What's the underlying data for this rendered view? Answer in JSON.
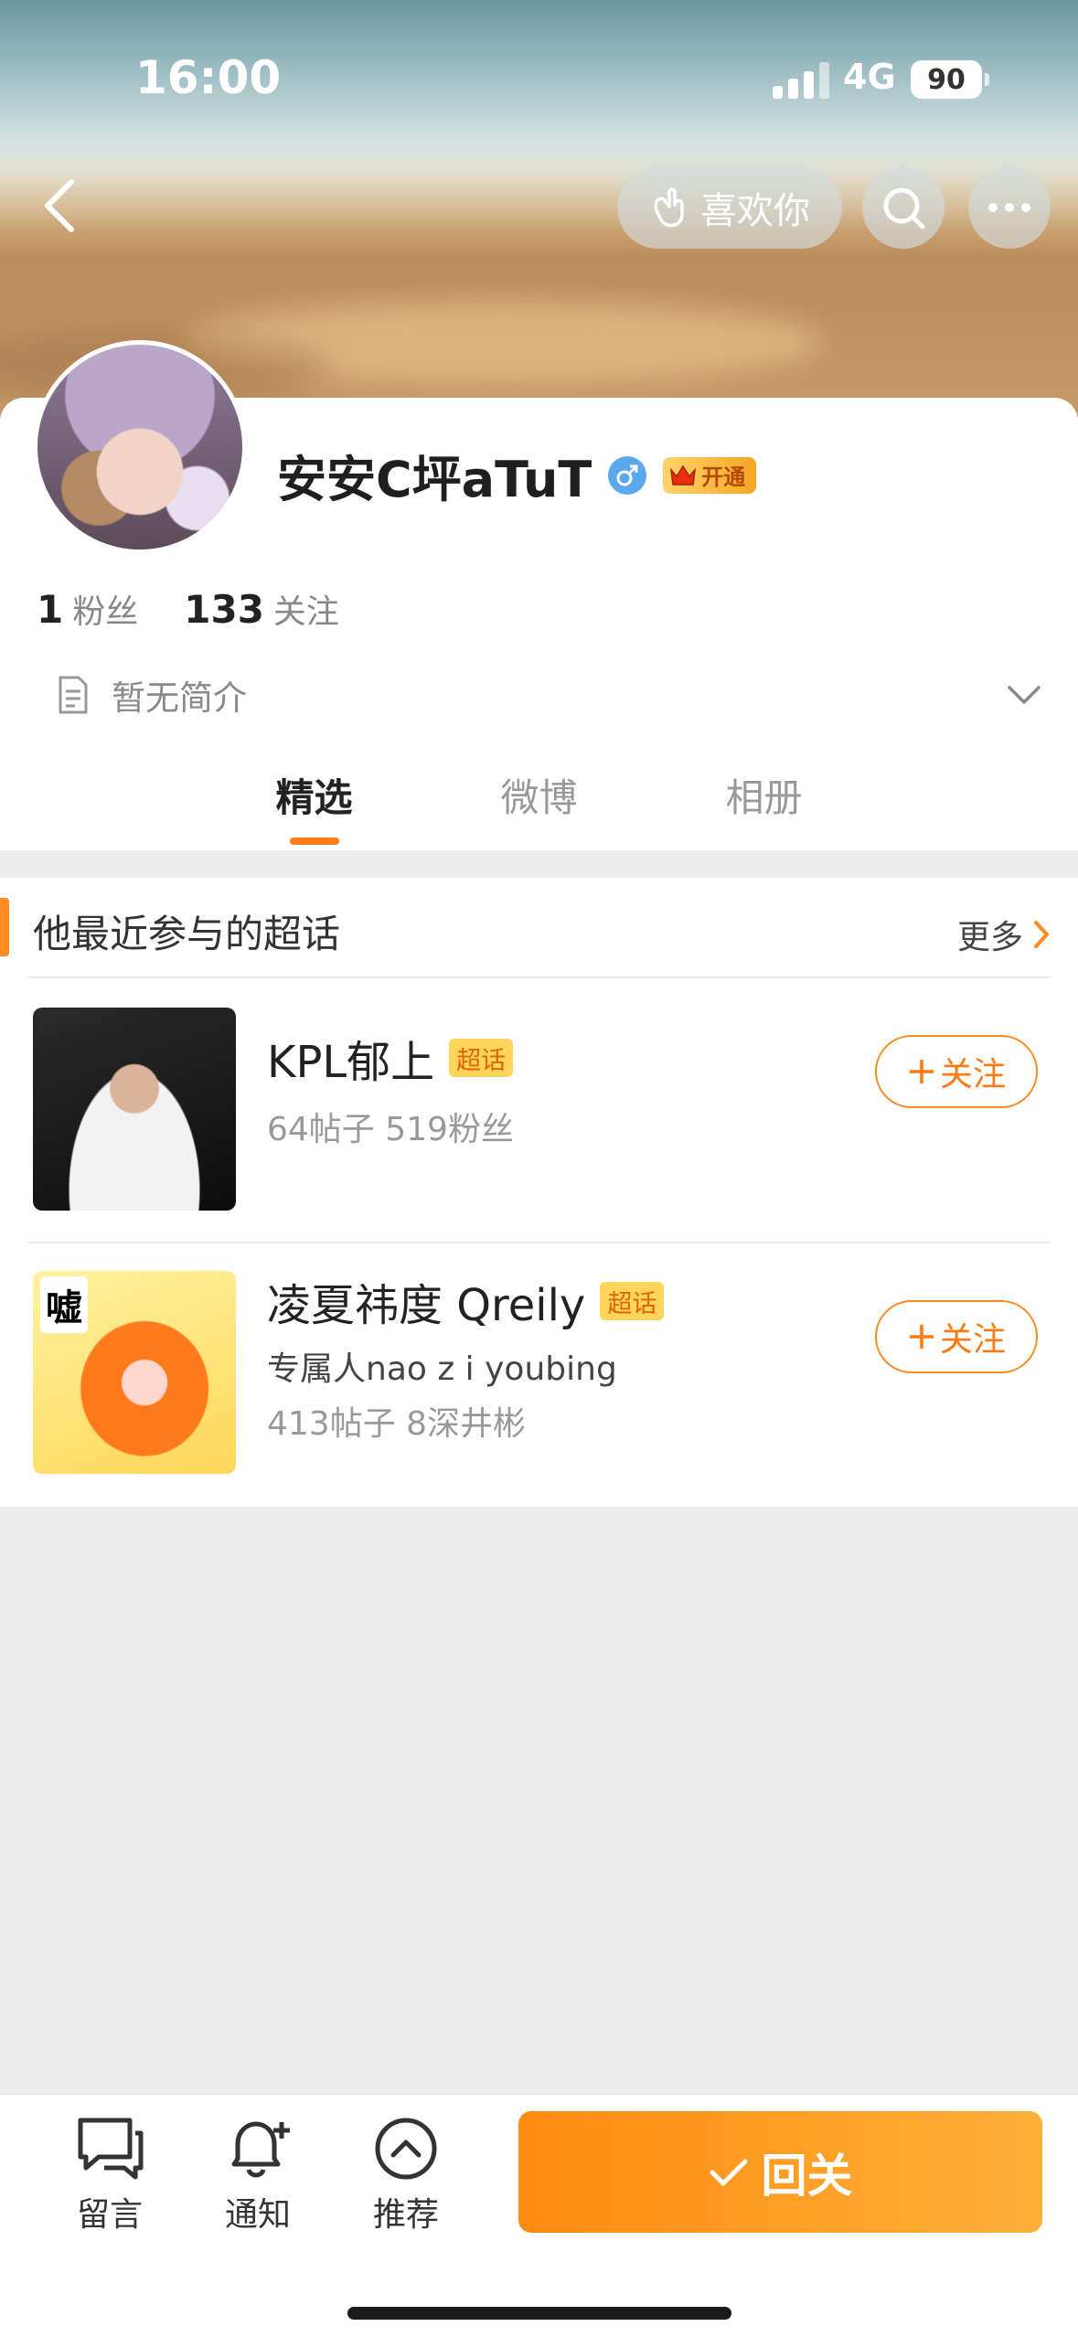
{
  "status_bar": {
    "time": "16:00",
    "network": "4G",
    "battery": "90"
  },
  "header": {
    "like_label": "喜欢你"
  },
  "profile": {
    "username": "安安C坪aTuT",
    "vip_label": "开通",
    "followers_count": "1",
    "followers_label": "粉丝",
    "following_count": "133",
    "following_label": "关注",
    "bio": "暂无简介"
  },
  "tabs": [
    {
      "label": "精选"
    },
    {
      "label": "微博"
    },
    {
      "label": "相册"
    }
  ],
  "topics": {
    "title": "他最近参与的超话",
    "more_label": "更多",
    "items": [
      {
        "name": "KPL郁上",
        "badge": "超话",
        "subtitle": "",
        "meta": "64帖子 519粉丝",
        "follow_label": "关注"
      },
      {
        "name": "凌夏祎度 Qreily",
        "badge": "超话",
        "thumb_label": "嘘",
        "subtitle": "专属人nao z i youbing",
        "meta": "413帖子 8深井彬",
        "follow_label": "关注"
      }
    ]
  },
  "bottom_bar": {
    "message_label": "留言",
    "notify_label": "通知",
    "recommend_label": "推荐",
    "follow_back_label": "回关"
  },
  "colors": {
    "accent": "#ff8a1f",
    "super_badge_bg": "#ffd45a"
  }
}
